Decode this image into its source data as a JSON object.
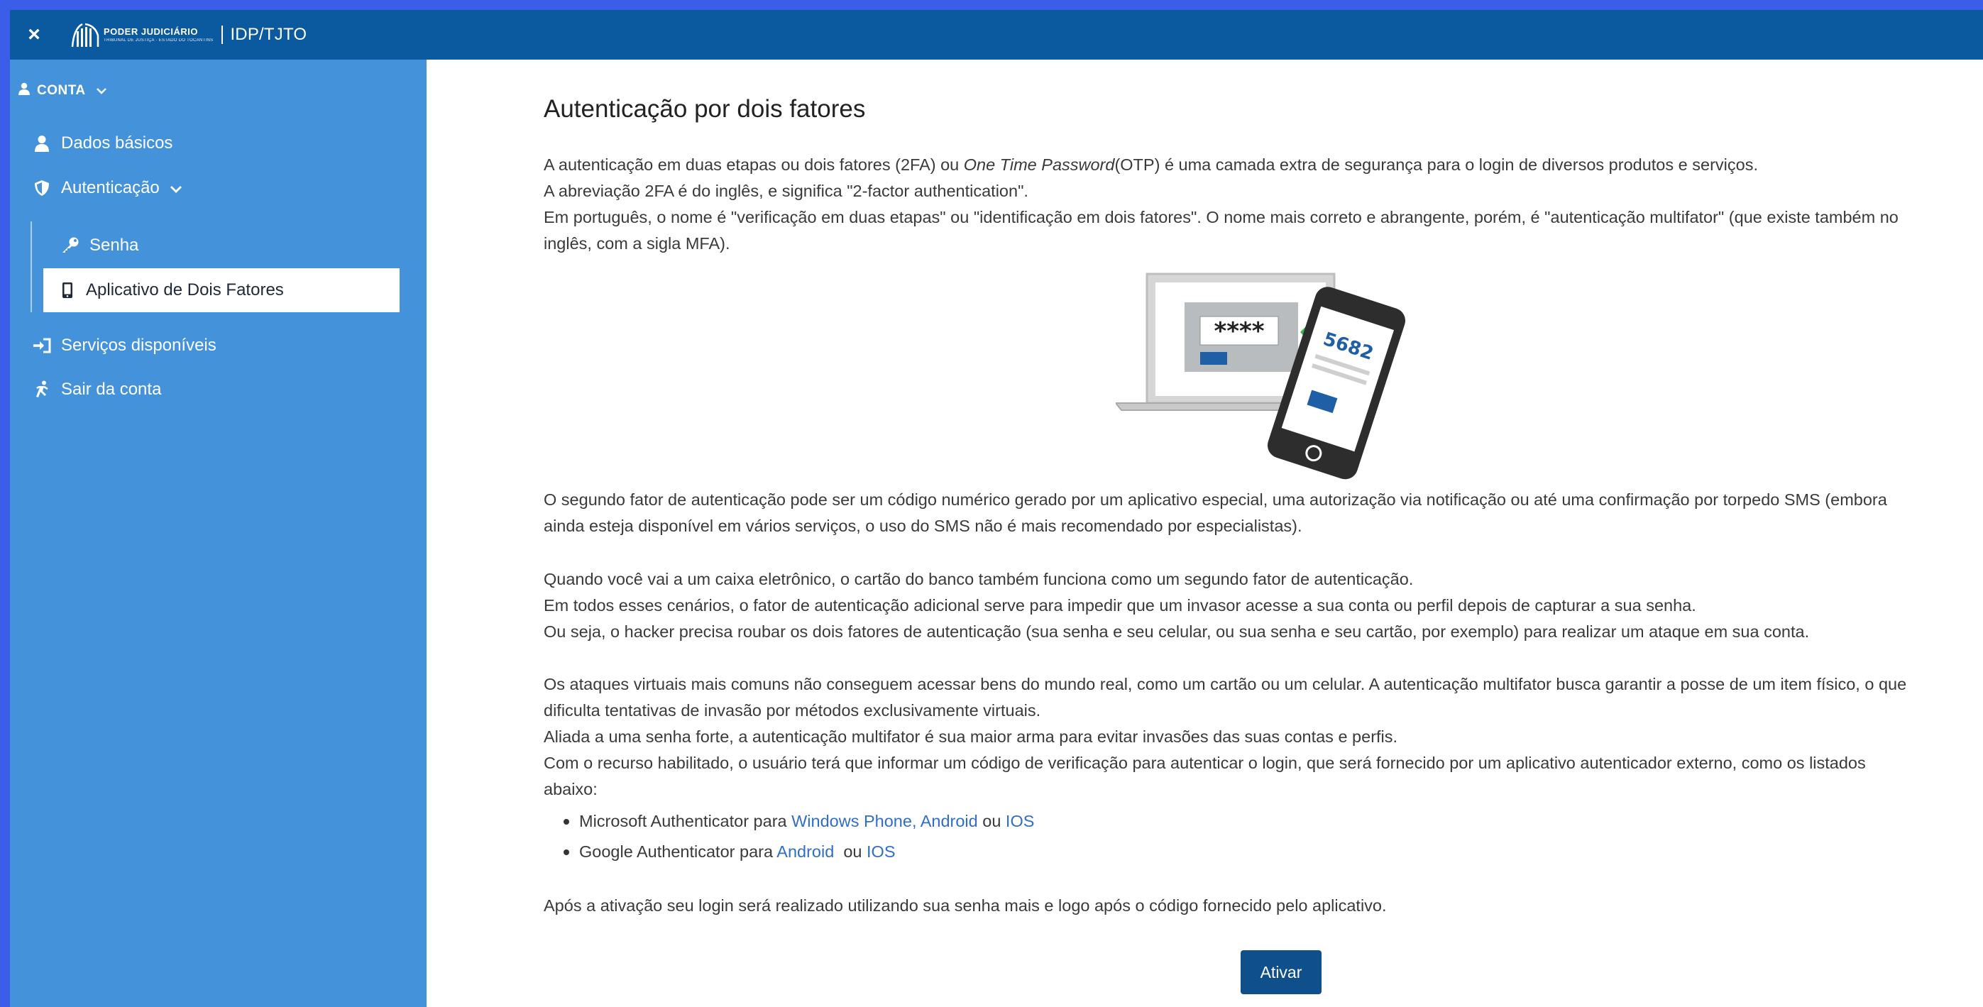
{
  "topbar": {
    "close_label": "×",
    "logo_main": "PODER JUDICIÁRIO",
    "logo_sub": "TRIBUNAL DE JUSTIÇA · ESTADO DO TOCANTINS",
    "app_name": "IDP/TJTO",
    "color": "#0b5aa0"
  },
  "sidebar": {
    "color": "#4392da",
    "header": "CONTA",
    "items": [
      {
        "label": "Dados básicos",
        "icon": "user-icon"
      },
      {
        "label": "Autenticação",
        "icon": "shield-icon"
      },
      {
        "label": "Senha",
        "icon": "key-icon"
      },
      {
        "label": "Aplicativo de Dois Fatores",
        "icon": "mobile-icon",
        "active": true
      },
      {
        "label": "Serviços disponíveis",
        "icon": "sign-in-icon"
      },
      {
        "label": "Sair da conta",
        "icon": "running-icon"
      }
    ]
  },
  "main": {
    "title": "Autenticação por dois fatores",
    "intro": {
      "l1_pre": "A autenticação em duas etapas ou dois fatores (2FA) ou ",
      "l1_em": "One Time Password",
      "l1_post": "(OTP) é uma camada extra de segurança para o login de diversos produtos e serviços.",
      "l2": "A abreviação 2FA é do inglês, e significa \"2-factor authentication\".",
      "l3": "Em português, o nome é \"verificação em duas etapas\" ou \"identificação em dois fatores\". O nome mais correto e abrangente, porém, é \"autenticação multifator\" (que existe também no",
      "l4": "inglês, com a sigla MFA)."
    },
    "illustration": {
      "password_mask": "****",
      "phone_code": "5682"
    },
    "p2": {
      "l1": "O segundo fator de autenticação pode ser um código numérico gerado por um aplicativo especial, uma autorização via notificação ou até uma confirmação por torpedo SMS (embora",
      "l2": "ainda esteja disponível em vários serviços, o uso do SMS não é mais recomendado por especialistas)."
    },
    "p3": {
      "l1": "Quando você vai a um caixa eletrônico, o cartão do banco também funciona como um segundo fator de autenticação.",
      "l2": "Em todos esses cenários, o fator de autenticação adicional serve para impedir que um invasor acesse a sua conta ou perfil depois de capturar a sua senha.",
      "l3": "Ou seja, o hacker precisa roubar os dois fatores de autenticação (sua senha e seu celular, ou sua senha e seu cartão, por exemplo) para realizar um ataque em sua conta."
    },
    "p4": {
      "l1": "Os ataques virtuais mais comuns não conseguem acessar bens do mundo real, como um cartão ou um celular. A autenticação multifator busca garantir a posse de um item físico, o que",
      "l2": "dificulta tentativas de invasão por métodos exclusivamente virtuais.",
      "l3": "Aliada a uma senha forte, a autenticação multifator é sua maior arma para evitar invasões das suas contas e perfis.",
      "l4": "Com o recurso habilitado, o usuário terá que informar um código de verificação para autenticar o login, que será fornecido por um aplicativo autenticador externo, como os listados",
      "l5": "abaixo:"
    },
    "apps": [
      {
        "prefix": "Microsoft Authenticator para ",
        "link1": "Windows Phone",
        "sep": ", ",
        "link2": "Android",
        "or": " ou ",
        "link3": "IOS"
      },
      {
        "prefix": "Google Authenticator para ",
        "link1": "Android",
        "or": "  ou ",
        "link2": "IOS"
      }
    ],
    "final": "Após a ativação seu login será realizado utilizando sua senha mais e logo após o código fornecido pelo aplicativo.",
    "button_label": "Ativar"
  }
}
